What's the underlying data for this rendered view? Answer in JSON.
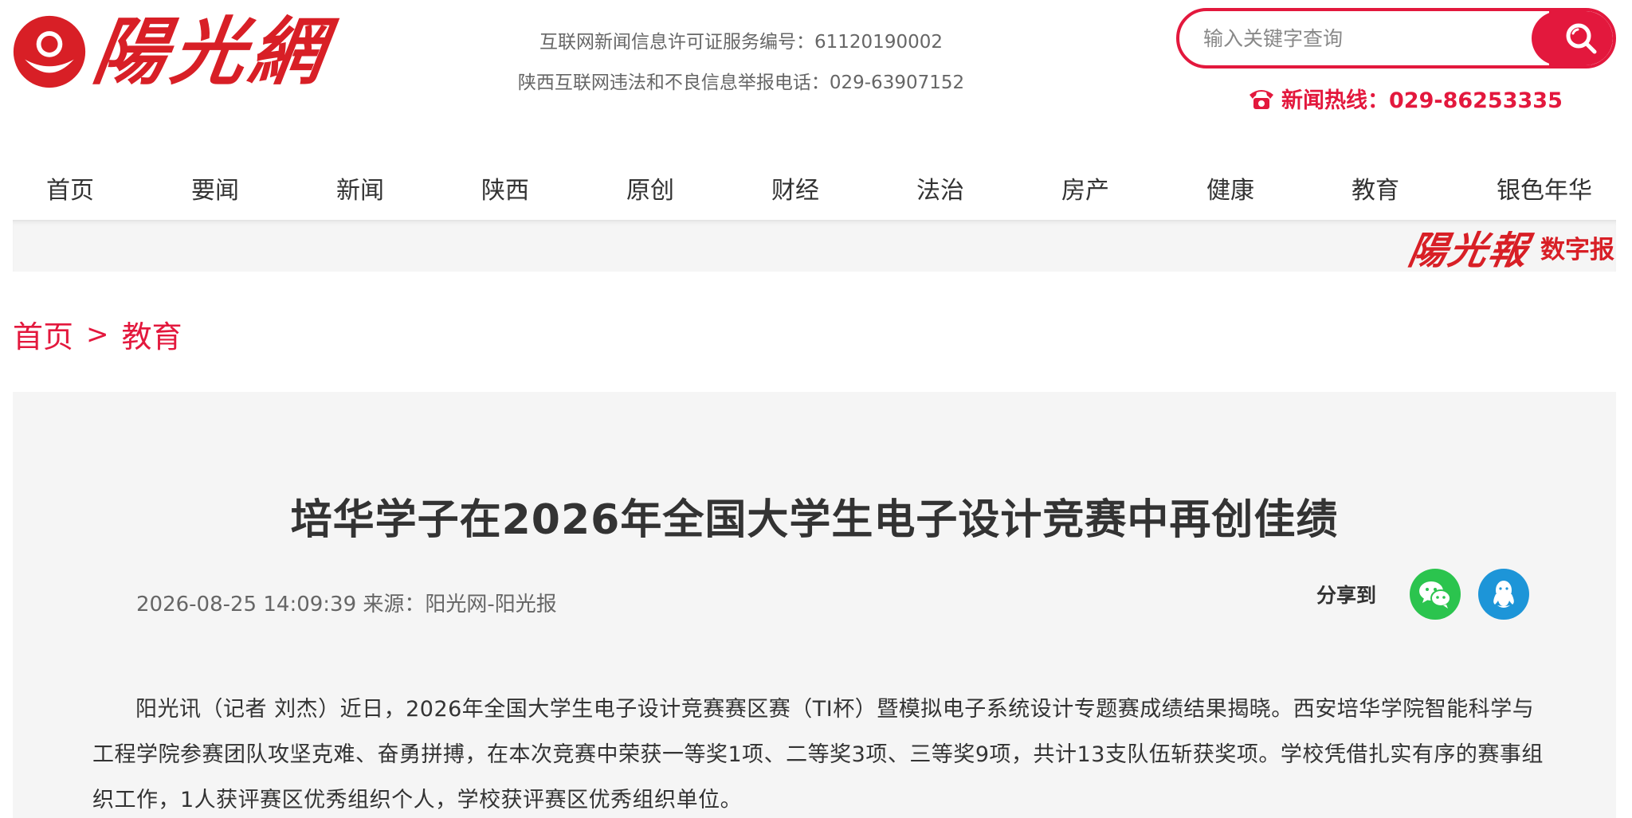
{
  "site": {
    "logo_text": "陽光網",
    "license_line1": "互联网新闻信息许可证服务编号：61120190002",
    "license_line2": "陕西互联网违法和不良信息举报电话：029-63907152",
    "search_placeholder": "输入关键字查询",
    "hotline": "新闻热线：029-86253335"
  },
  "nav": {
    "items": [
      "首页",
      "要闻",
      "新闻",
      "陕西",
      "原创",
      "财经",
      "法治",
      "房产",
      "健康",
      "教育",
      "银色年华"
    ]
  },
  "banner": {
    "epaper_logo": "陽光報",
    "epaper_label": "数字报"
  },
  "breadcrumb": {
    "home": "首页",
    "separator": ">",
    "current": "教育"
  },
  "article": {
    "title": "培华学子在2026年全国大学生电子设计竞赛中再创佳绩",
    "meta": "2026-08-25 14:09:39 来源：阳光网-阳光报",
    "share_label": "分享到",
    "body": "阳光讯（记者 刘杰）近日，2026年全国大学生电子设计竞赛赛区赛（TI杯）暨模拟电子系统设计专题赛成绩结果揭晓。西安培华学院智能科学与工程学院参赛团队攻坚克难、奋勇拼搏，在本次竞赛中荣获一等奖1项、二等奖3项、三等奖9项，共计13支队伍斩获奖项。学校凭借扎实有序的赛事组织工作，1人获评赛区优秀组织个人，学校获评赛区优秀组织单位。"
  },
  "colors": {
    "brand_red": "#e3183d",
    "logo_red": "#d81f26",
    "wechat_green": "#2bc44e",
    "qq_blue": "#1d95d8"
  },
  "icons": {
    "logo": "sun-emblem-icon",
    "search": "search-icon",
    "hotline": "phone-icon",
    "wechat": "wechat-icon",
    "qq": "qq-icon"
  }
}
